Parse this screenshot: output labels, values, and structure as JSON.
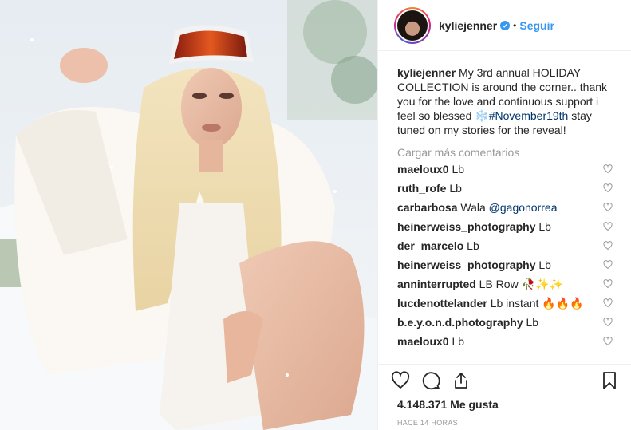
{
  "post": {
    "image_alt": "Woman with long platinum blonde hair wearing ski goggles and a white fur coat sitting in snow"
  },
  "header": {
    "username": "kyliejenner",
    "verified": true,
    "separator": "•",
    "follow_label": "Seguir"
  },
  "caption": {
    "username": "kyliejenner",
    "text_before": " My 3rd annual HOLIDAY COLLECTION is around the corner.. thank you for the love and continuous support i feel so blessed ",
    "emoji": "❄️",
    "hashtag": "#November19th",
    "text_after": " stay tuned on my stories for the reveal!"
  },
  "load_more_label": "Cargar más comentarios",
  "comments": [
    {
      "user": "maeloux0",
      "text": "Lb"
    },
    {
      "user": "ruth_rofe",
      "text": "Lb"
    },
    {
      "user": "carbarbosa",
      "text": "Wala",
      "mention": "@gagonorrea"
    },
    {
      "user": "heinerweiss_photography",
      "text": "Lb"
    },
    {
      "user": "der_marcelo",
      "text": "Lb"
    },
    {
      "user": "heinerweiss_photography",
      "text": "Lb"
    },
    {
      "user": "anninterrupted",
      "text": "LB Row 🥀✨✨"
    },
    {
      "user": "lucdenottelander",
      "text": "Lb instant 🔥🔥🔥"
    },
    {
      "user": "b.e.y.o.n.d.photography",
      "text": "Lb"
    },
    {
      "user": "maeloux0",
      "text": "Lb"
    }
  ],
  "actions": {
    "likes": "4.148.371 Me gusta",
    "time": "HACE 14 HORAS"
  },
  "icons": {
    "like": "heart-icon",
    "comment": "comment-icon",
    "share": "share-icon",
    "save": "bookmark-icon"
  },
  "colors": {
    "link_blue": "#3897f0",
    "hashtag": "#003569",
    "muted": "#999999"
  }
}
